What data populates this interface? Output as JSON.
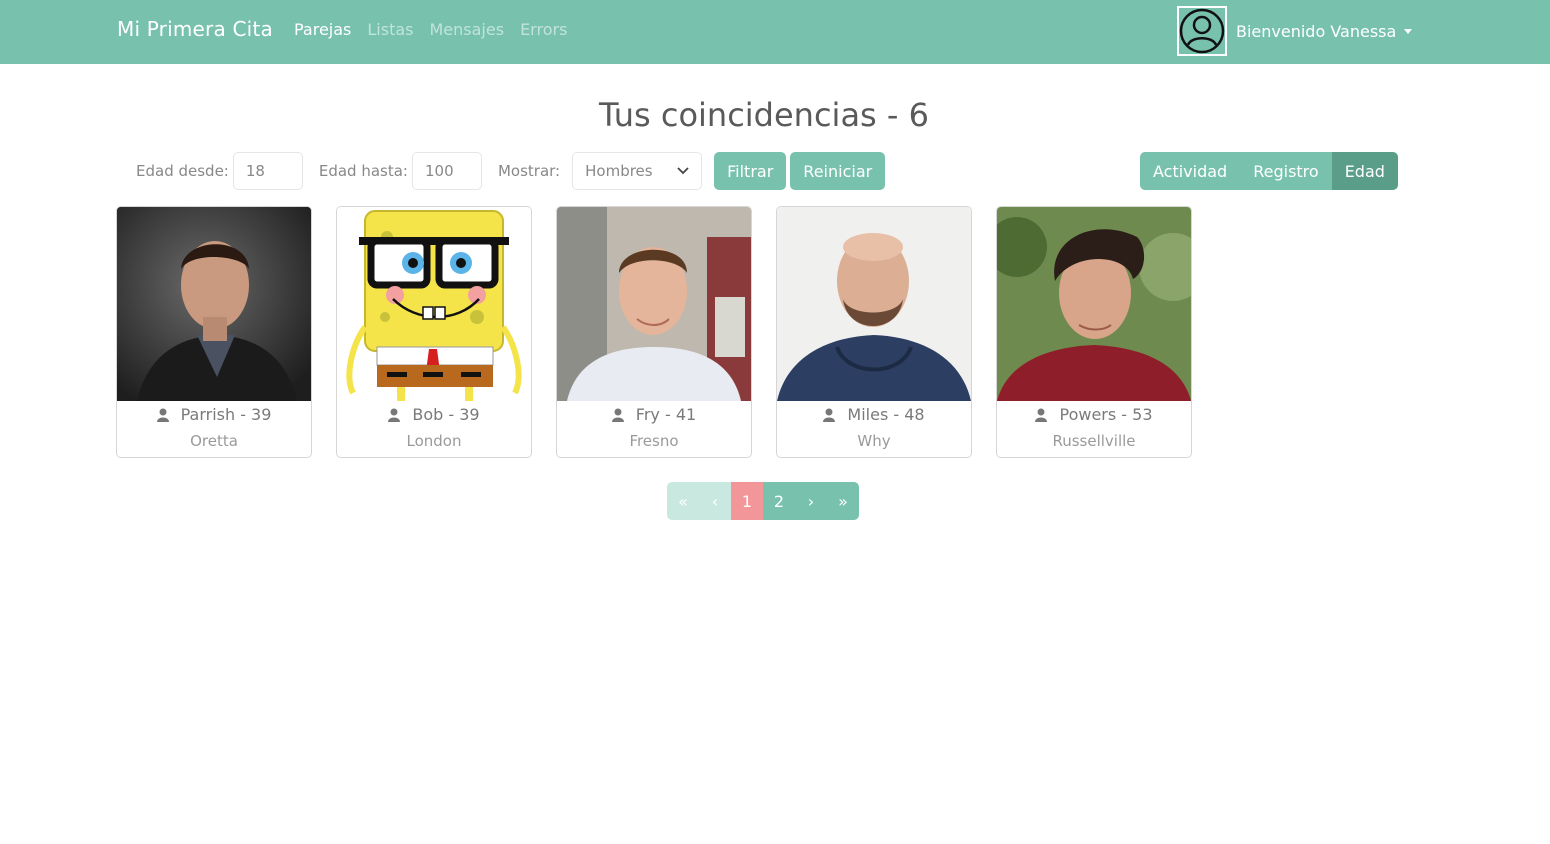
{
  "navbar": {
    "brand": "Mi Primera Cita",
    "links": [
      {
        "label": "Parejas",
        "active": true
      },
      {
        "label": "Listas",
        "active": false
      },
      {
        "label": "Mensajes",
        "active": false
      },
      {
        "label": "Errors",
        "active": false
      }
    ],
    "welcome": "Bienvenido Vanessa",
    "avatar_icon": "user-circle-icon"
  },
  "page": {
    "title": "Tus coincidencias - 6"
  },
  "filters": {
    "min_age_label": "Edad desde:",
    "min_age_value": "18",
    "max_age_label": "Edad hasta:",
    "max_age_value": "100",
    "show_label": "Mostrar:",
    "show_value": "Hombres",
    "filter_button": "Filtrar",
    "reset_button": "Reiniciar"
  },
  "sort": {
    "buttons": [
      {
        "label": "Actividad",
        "active": false
      },
      {
        "label": "Registro",
        "active": false
      },
      {
        "label": "Edad",
        "active": true
      }
    ]
  },
  "members": [
    {
      "name_age": "Parrish - 39",
      "city": "Oretta",
      "icon": "user-icon"
    },
    {
      "name_age": "Bob - 39",
      "city": "London",
      "icon": "user-icon"
    },
    {
      "name_age": "Fry - 41",
      "city": "Fresno",
      "icon": "user-icon"
    },
    {
      "name_age": "Miles - 48",
      "city": "Why",
      "icon": "user-icon"
    },
    {
      "name_age": "Powers - 53",
      "city": "Russellville",
      "icon": "user-icon"
    }
  ],
  "pagination": {
    "first": "«",
    "prev": "‹",
    "pages": [
      "1",
      "2"
    ],
    "current": "1",
    "next": "›",
    "last": "»"
  },
  "colors": {
    "primary": "#78c2ad",
    "primary_dark": "#5a9e8a",
    "current_page": "#f3969a"
  }
}
